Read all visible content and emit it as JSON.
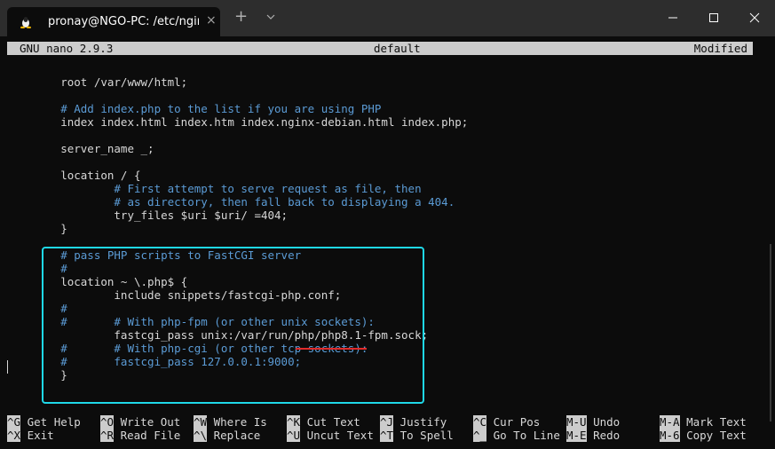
{
  "window": {
    "tab_title": "pronay@NGO-PC: /etc/nginx/si",
    "tab_icon": "linux-penguin-icon",
    "tab_close": "×",
    "new_tab": "+",
    "controls": [
      "minimize",
      "maximize",
      "close"
    ]
  },
  "nano": {
    "version_label": "GNU nano 2.9.3",
    "filename": "default",
    "status": "Modified"
  },
  "editor": {
    "lines": [
      {
        "text": "        root /var/www/html;",
        "type": "code"
      },
      {
        "text": "",
        "type": "code"
      },
      {
        "text": "        # Add index.php to the list if you are using PHP",
        "type": "comment"
      },
      {
        "text": "        index index.html index.htm index.nginx-debian.html index.php;",
        "type": "code"
      },
      {
        "text": "",
        "type": "code"
      },
      {
        "text": "        server_name _;",
        "type": "code"
      },
      {
        "text": "",
        "type": "code"
      },
      {
        "text": "        location / {",
        "type": "code"
      },
      {
        "text": "                # First attempt to serve request as file, then",
        "type": "comment"
      },
      {
        "text": "                # as directory, then fall back to displaying a 404.",
        "type": "comment"
      },
      {
        "text": "                try_files $uri $uri/ =404;",
        "type": "code"
      },
      {
        "text": "        }",
        "type": "code"
      },
      {
        "text": "",
        "type": "code"
      },
      {
        "text": "        # pass PHP scripts to FastCGI server",
        "type": "comment"
      },
      {
        "text": "        #",
        "type": "comment"
      },
      {
        "text": "        location ~ \\.php$ {",
        "type": "code"
      },
      {
        "text": "                include snippets/fastcgi-php.conf;",
        "type": "code"
      },
      {
        "text": "        #",
        "type": "comment"
      },
      {
        "text": "        #       # With php-fpm (or other unix sockets):",
        "type": "comment"
      },
      {
        "text": "                fastcgi_pass unix:/var/run/php/php8.1-fpm.sock;",
        "type": "code"
      },
      {
        "text": "        #       # With php-cgi (or other tcp sockets):",
        "type": "comment"
      },
      {
        "text": "        #       fastcgi_pass 127.0.0.1:9000;",
        "type": "comment"
      },
      {
        "text": "        }",
        "type": "code"
      }
    ],
    "underlined_text": "php8.1-fpm"
  },
  "colors": {
    "highlight_box": "#1fd8e8",
    "underline": "#e02b2b",
    "comment": "#5b9bd5"
  },
  "shortcuts": [
    {
      "key": "^G",
      "label": "Get Help"
    },
    {
      "key": "^X",
      "label": "Exit"
    },
    {
      "key": "^O",
      "label": "Write Out"
    },
    {
      "key": "^R",
      "label": "Read File"
    },
    {
      "key": "^W",
      "label": "Where Is"
    },
    {
      "key": "^\\",
      "label": "Replace"
    },
    {
      "key": "^K",
      "label": "Cut Text"
    },
    {
      "key": "^U",
      "label": "Uncut Text"
    },
    {
      "key": "^J",
      "label": "Justify"
    },
    {
      "key": "^T",
      "label": "To Spell"
    },
    {
      "key": "^C",
      "label": "Cur Pos"
    },
    {
      "key": "^_",
      "label": "Go To Line"
    },
    {
      "key": "M-U",
      "label": "Undo"
    },
    {
      "key": "M-E",
      "label": "Redo"
    },
    {
      "key": "M-A",
      "label": "Mark Text"
    },
    {
      "key": "M-6",
      "label": "Copy Text"
    }
  ]
}
